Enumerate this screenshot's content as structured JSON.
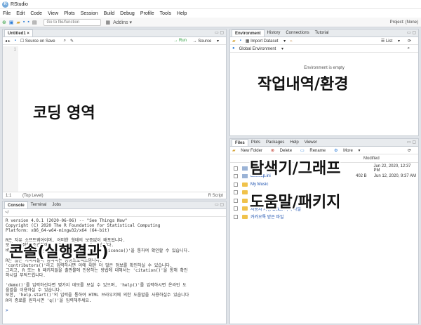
{
  "window": {
    "title": "RStudio",
    "app_icon": "R"
  },
  "menu": [
    "File",
    "Edit",
    "Code",
    "View",
    "Plots",
    "Session",
    "Build",
    "Debug",
    "Profile",
    "Tools",
    "Help"
  ],
  "toolbar": {
    "goto_placeholder": "Go to file/function",
    "addins": "Addins",
    "project": "Project: (None)"
  },
  "source": {
    "tab": "Untitled1",
    "source_on_save": "Source on Save",
    "run": "Run",
    "source_btn": "Source",
    "line_number": "1",
    "status_pos": "1:1",
    "status_scope": "(Top Level)",
    "status_type": "R Script"
  },
  "console": {
    "tabs": [
      "Console",
      "Terminal",
      "Jobs"
    ],
    "path": "~/",
    "lines": [
      "R version 4.0.1 (2020-06-06) -- \"See Things Now\"",
      "Copyright (C) 2020 The R Foundation for Statistical Computing",
      "Platform: x86_64-w64-mingw32/x64 (64-bit)",
      "",
      "R은 자유 소프트웨어이며, 어떠한 형태의 보증없이 배포됩니다.",
      "또한, 일정한 조건하에서 이것을 재배포 할 수 있습니다.",
      "배포와 관련된 상세한 내용은 'license()' 또는 'licence()'을 통하여 확인할 수 있습니다.",
      "",
      "R은 많은 기여자들이 참여하는 공동프로젝트입니다.",
      "'contributors()'라고 입력하시면 이에 대한 더 많은 정보를 확인하실 수 있습니다.",
      "그리고, R 또는 R 패키지들을 출판물에 인용하는 방법에 대해서는 'citation()'을 통해 확인",
      "하시길 부탁드립니다.",
      "",
      "'demo()'를 입력하신다면 몇가지 데모를 보실 수 있으며, 'help()'를 입력하시면 온라인 도",
      "움말을 이용하실 수 있습니다.",
      "또한, 'help.start()'의 입력을 통하여 HTML 브라우저에 의한 도움말을 사용하실수 있습니다",
      "R의 종료를 원하시면 'q()'을 입력해주세요."
    ],
    "prompt": ">"
  },
  "environment": {
    "tabs": [
      "Environment",
      "History",
      "Connections",
      "Tutorial"
    ],
    "import_dataset": "Import Dataset",
    "list_view": "List",
    "scope": "Global Environment",
    "empty_message": "Environment is empty"
  },
  "files": {
    "tabs": [
      "Files",
      "Plots",
      "Packages",
      "Help",
      "Viewer"
    ],
    "new_folder": "New Folder",
    "delete": "Delete",
    "rename": "Rename",
    "more": "More",
    "modified_header": "Modified",
    "rows": [
      {
        "name": "",
        "size": "",
        "modified": "Jun 22, 2020, 12:37 PM",
        "kind": "doc"
      },
      {
        "name": "desktop.ini",
        "size": "402 B",
        "modified": "Jun 12, 2020, 9:37 AM",
        "kind": "doc"
      },
      {
        "name": "My Music",
        "size": "",
        "modified": "",
        "kind": "folder"
      },
      {
        "name": "",
        "size": "",
        "modified": "",
        "kind": "folder"
      },
      {
        "name": "",
        "size": "",
        "modified": "",
        "kind": "folder"
      },
      {
        "name": "사용자 지정 Office 서식 파일",
        "size": "",
        "modified": "",
        "kind": "folder"
      },
      {
        "name": "카카오톡 받은 파일",
        "size": "",
        "modified": "",
        "kind": "folder"
      }
    ]
  },
  "annotations": {
    "coding": "코딩 영역",
    "environment": "작업내역/환경",
    "explorer": "탐색기/그래프",
    "help": "도움말/패키지",
    "console": "콘솔(실행결과)"
  }
}
